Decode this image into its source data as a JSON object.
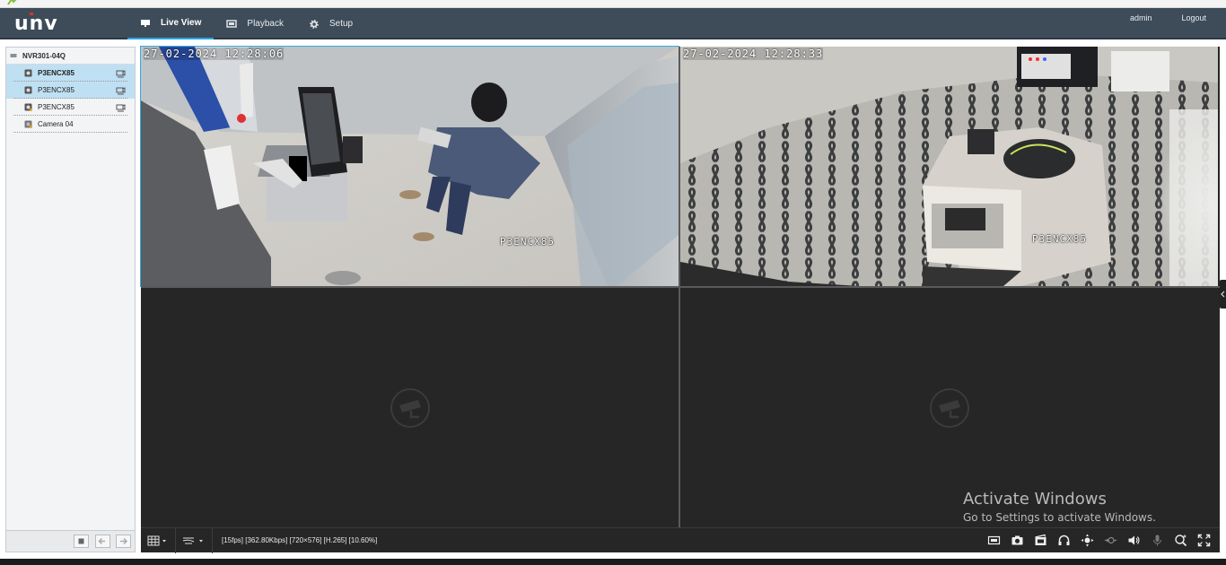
{
  "app": {
    "logo_text": "unv"
  },
  "nav": {
    "items": [
      {
        "label": "Live View",
        "icon": "monitor-icon",
        "active": true
      },
      {
        "label": "Playback",
        "icon": "playback-icon",
        "active": false
      },
      {
        "label": "Setup",
        "icon": "gear-icon",
        "active": false
      }
    ],
    "user": "admin",
    "logout": "Logout"
  },
  "sidebar": {
    "device": "NVR301-04Q",
    "cameras": [
      {
        "label": "P3ENCX85",
        "state": "selected-playing"
      },
      {
        "label": "P3ENCX85",
        "state": "selected"
      },
      {
        "label": "P3ENCX85",
        "state": "normal"
      },
      {
        "label": "Camera 04",
        "state": "offline"
      }
    ]
  },
  "panes": [
    {
      "timestamp": "27-02-2024 12:28:06",
      "label": "P3ENCX85",
      "has_video": true,
      "active": true
    },
    {
      "timestamp": "27-02-2024 12:28:33",
      "label": "P3ENCX85",
      "has_video": true,
      "active": false
    },
    {
      "timestamp": "",
      "label": "",
      "has_video": false,
      "active": false
    },
    {
      "timestamp": "",
      "label": "",
      "has_video": false,
      "active": false
    }
  ],
  "toolbar": {
    "stream_info": "[15fps] [362.80Kbps] [720×576] [H.265] [10.60%]",
    "right_icons": [
      "snapshot-frame-icon",
      "camera-icon",
      "clip-icon",
      "headset-icon",
      "ptz-icon",
      "digital-zoom-icon",
      "volume-icon",
      "microphone-icon",
      "zoom-search-icon",
      "fullscreen-icon"
    ]
  },
  "watermark": {
    "line1": "Activate Windows",
    "line2": "Go to Settings to activate Windows."
  },
  "colors": {
    "header": "#3e4c59",
    "accent": "#34a9e0",
    "selection": "#bfe0f3",
    "video_bg": "#262626"
  }
}
